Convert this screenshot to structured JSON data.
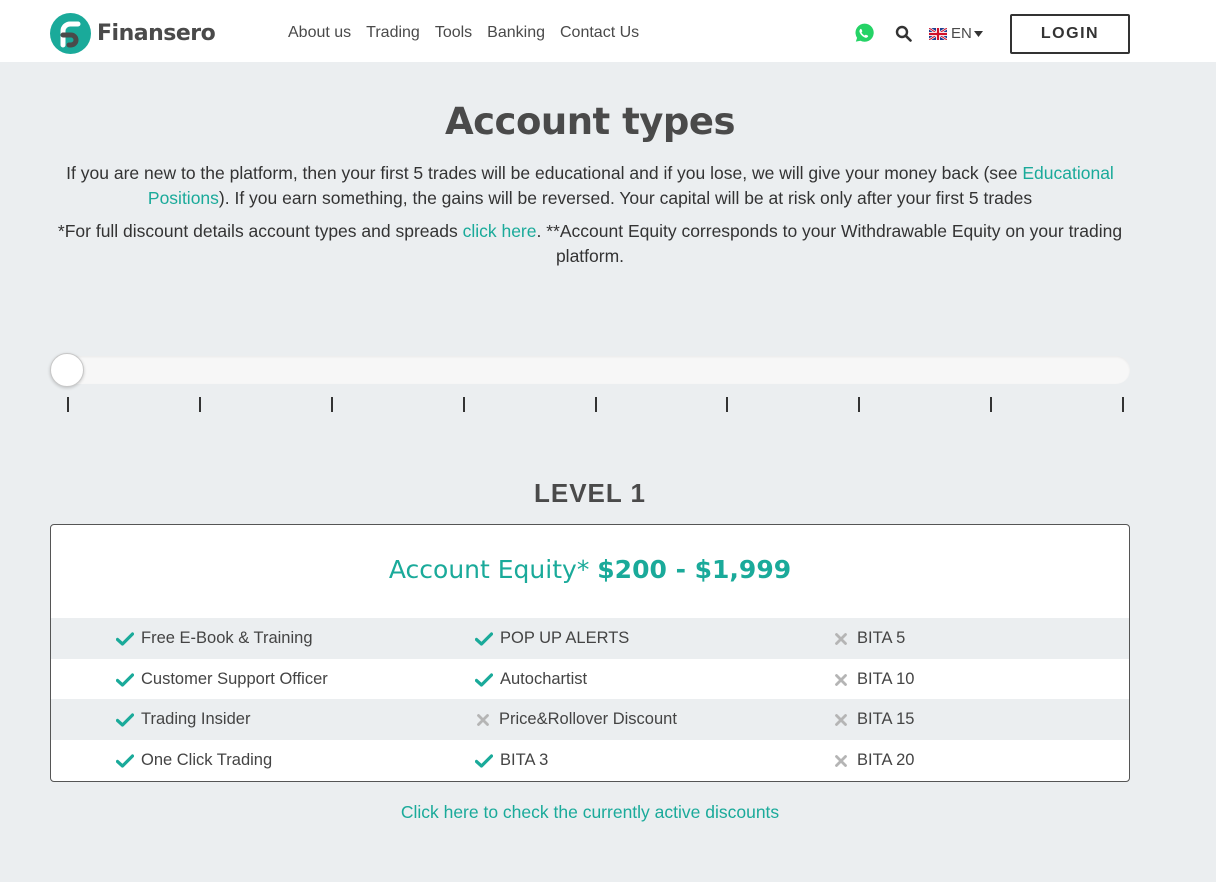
{
  "header": {
    "brand": "Finansero",
    "nav": [
      "About us",
      "Trading",
      "Tools",
      "Banking",
      "Contact Us"
    ],
    "language": "EN",
    "login_label": "LOGIN",
    "colors": {
      "accent": "#1aaa9a",
      "whatsapp": "#25d366"
    }
  },
  "page": {
    "title": "Account types",
    "intro1_a": "If you are new to the platform, then your first 5 trades will be educational and if you lose, we will give your money back (see ",
    "intro1_link": "Educational Positions",
    "intro1_b": "). If you earn something, the gains will be reversed. Your capital will be at risk only after your first 5 trades",
    "intro2_a": "*For full discount details account types and spreads ",
    "intro2_link": "click here",
    "intro2_b": ". **Account Equity corresponds to your Withdrawable Equity on your trading platform."
  },
  "slider": {
    "position": 0,
    "tick_count": 9
  },
  "level": {
    "title": "LEVEL 1",
    "equity_label": "Account Equity*",
    "equity_range": "$200 - $1,999",
    "features": [
      [
        {
          "label": "Free E-Book & Training",
          "included": true
        },
        {
          "label": "POP UP ALERTS",
          "included": true
        },
        {
          "label": "BITA 5",
          "included": false
        }
      ],
      [
        {
          "label": "Customer Support Officer",
          "included": true
        },
        {
          "label": "Autochartist",
          "included": true
        },
        {
          "label": "BITA 10",
          "included": false
        }
      ],
      [
        {
          "label": "Trading Insider",
          "included": true
        },
        {
          "label": "Price&Rollover Discount",
          "included": false
        },
        {
          "label": "BITA 15",
          "included": false
        }
      ],
      [
        {
          "label": "One Click Trading",
          "included": true
        },
        {
          "label": "BITA 3",
          "included": true
        },
        {
          "label": "BITA 20",
          "included": false
        }
      ]
    ]
  },
  "discounts_link": "Click here to check the currently active discounts"
}
